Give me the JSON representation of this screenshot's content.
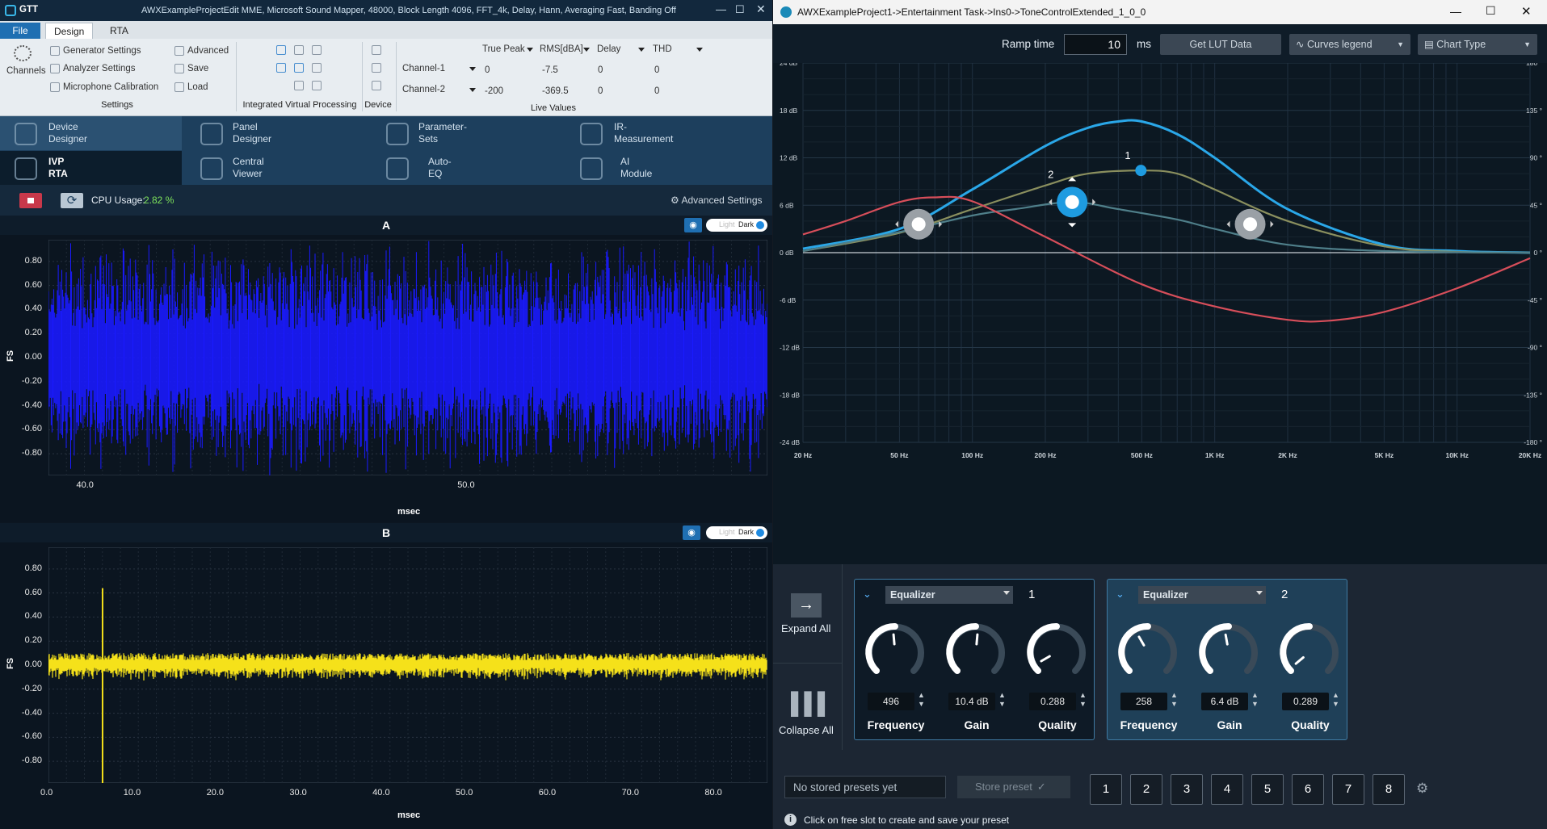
{
  "left_window": {
    "app": "GTT",
    "title": "AWXExampleProjectEdit MME, Microsoft Sound Mapper, 48000, Block Length 4096, FFT_4k, Delay, Hann, Averaging Fast, Banding Off",
    "tabs": [
      "File",
      "Design",
      "RTA"
    ],
    "ribbon": {
      "channels": "Channels",
      "settings_items": [
        "Generator Settings",
        "Analyzer Settings",
        "Microphone Calibration"
      ],
      "settings_right": [
        "Advanced",
        "Save",
        "Load"
      ],
      "settings_group": "Settings",
      "ivp_group": "Integrated Virtual Processing",
      "device_group": "Device",
      "live_headers": [
        "True Peak",
        "RMS[dBA]",
        "Delay",
        "THD"
      ],
      "live_rows": [
        {
          "name": "Channel-1",
          "peak": "0",
          "rms": "-7.5",
          "delay": "0",
          "thd": "0"
        },
        {
          "name": "Channel-2",
          "peak": "-200",
          "rms": "-369.5",
          "delay": "0",
          "thd": "0"
        }
      ],
      "live_group": "Live Values"
    },
    "nav": [
      {
        "l1": "Device",
        "l2": "Designer"
      },
      {
        "l1": "Panel",
        "l2": "Designer"
      },
      {
        "l1": "Parameter-",
        "l2": "Sets"
      },
      {
        "l1": "IR-",
        "l2": "Measurement"
      },
      {
        "l1": "IVP",
        "l2": "RTA"
      },
      {
        "l1": "Central",
        "l2": "Viewer"
      },
      {
        "l1": "Auto-",
        "l2": "EQ"
      },
      {
        "l1": "AI",
        "l2": "Module"
      }
    ],
    "cpu_label": "CPU Usage:",
    "cpu_value": "2.82 %",
    "advanced_settings": "Advanced Settings",
    "toggle_light": "Light",
    "toggle_dark": "Dark",
    "plot_a": {
      "title": "A",
      "ylabel": "FS",
      "xlabel": "msec",
      "yticks": [
        "0.80",
        "0.60",
        "0.40",
        "0.20",
        "0.00",
        "-0.20",
        "-0.40",
        "-0.60",
        "-0.80"
      ],
      "xticks": [
        "40.0",
        "50.0"
      ],
      "color": "#1a1aff"
    },
    "plot_b": {
      "title": "B",
      "ylabel": "FS",
      "xlabel": "msec",
      "yticks": [
        "0.80",
        "0.60",
        "0.40",
        "0.20",
        "0.00",
        "-0.20",
        "-0.40",
        "-0.60",
        "-0.80"
      ],
      "xticks": [
        "0.0",
        "10.0",
        "20.0",
        "30.0",
        "40.0",
        "50.0",
        "60.0",
        "70.0",
        "80.0"
      ],
      "color": "#f5e11a"
    }
  },
  "right_window": {
    "title": "AWXExampleProject1->Entertainment Task->Ins0->ToneControlExtended_1_0_0",
    "ramp_label": "Ramp time",
    "ramp_value": "10",
    "ramp_unit": "ms",
    "get_lut": "Get LUT Data",
    "curves_legend": "Curves legend",
    "chart_type": "Chart Type",
    "chart_data": {
      "type": "line",
      "y_left_ticks": [
        "24 dB",
        "18 dB",
        "12 dB",
        "6 dB",
        "0 dB",
        "-6 dB",
        "-12 dB",
        "-18 dB",
        "-24 dB"
      ],
      "y_right_ticks": [
        "180 °",
        "135 °",
        "90 °",
        "45 °",
        "0 °",
        "-45 °",
        "-90 °",
        "-135 °",
        "-180 °"
      ],
      "x_ticks": [
        "20 Hz",
        "50 Hz",
        "100 Hz",
        "200 Hz",
        "500 Hz",
        "1K Hz",
        "2K Hz",
        "5K Hz",
        "10K Hz",
        "20K Hz"
      ],
      "ylim": [
        -24,
        24
      ],
      "xlim_hz": [
        20,
        20000
      ],
      "x_scale": "log",
      "series": [
        {
          "color": "#2aa7e8",
          "x": [
            20,
            50,
            100,
            200,
            300,
            400,
            500,
            700,
            1000,
            2000,
            5000,
            10000,
            20000
          ],
          "y": [
            0.5,
            3,
            8,
            13.5,
            15.8,
            16.6,
            16.6,
            15,
            12,
            5.5,
            1,
            0.2,
            0
          ]
        },
        {
          "color": "#8a8f5e",
          "x": [
            20,
            50,
            100,
            200,
            300,
            500,
            700,
            1000,
            2000,
            5000,
            10000,
            20000
          ],
          "y": [
            0.2,
            2.5,
            5.5,
            8.5,
            10,
            10.4,
            10,
            8,
            4,
            0.8,
            0.1,
            0
          ]
        },
        {
          "color": "#4f7f8a",
          "x": [
            20,
            50,
            100,
            150,
            258,
            400,
            700,
            1000,
            2000,
            5000,
            20000
          ],
          "y": [
            0.2,
            2.6,
            4.7,
            5.5,
            6.4,
            5.5,
            4.2,
            3,
            1,
            0.2,
            0
          ]
        },
        {
          "color": "#d74e5a",
          "x": [
            20,
            30,
            50,
            70,
            100,
            200,
            500,
            1000,
            2000,
            3000,
            5000,
            10000,
            20000
          ],
          "y": [
            2.3,
            4,
            6.4,
            7,
            6.5,
            2,
            -4,
            -6.8,
            -8.5,
            -8.6,
            -7.5,
            -4.5,
            -0.7
          ]
        }
      ],
      "handle_labels": [
        "1",
        "2"
      ]
    },
    "expand_all": "Expand All",
    "collapse_all": "Collapse All",
    "eq": [
      {
        "type": "Equalizer",
        "index": "1",
        "frequency": "496",
        "gain": "10.4 dB",
        "quality": "0.288",
        "labels": [
          "Frequency",
          "Gain",
          "Quality"
        ]
      },
      {
        "type": "Equalizer",
        "index": "2",
        "frequency": "258",
        "gain": "6.4 dB",
        "quality": "0.289",
        "labels": [
          "Frequency",
          "Gain",
          "Quality"
        ]
      }
    ],
    "presets_empty": "No stored presets yet",
    "store_preset": "Store preset",
    "preset_slots": [
      "1",
      "2",
      "3",
      "4",
      "5",
      "6",
      "7",
      "8"
    ],
    "hint": "Click on free slot to create and save your preset"
  }
}
